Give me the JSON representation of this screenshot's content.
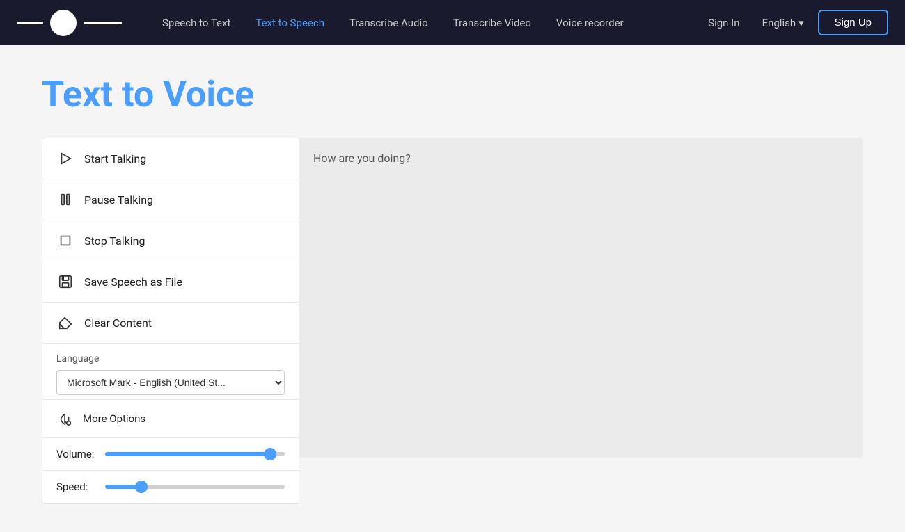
{
  "nav": {
    "links": [
      {
        "id": "speech-to-text",
        "label": "Speech to Text",
        "active": false
      },
      {
        "id": "text-to-speech",
        "label": "Text to Speech",
        "active": true
      },
      {
        "id": "transcribe-audio",
        "label": "Transcribe Audio",
        "active": false
      },
      {
        "id": "transcribe-video",
        "label": "Transcribe Video",
        "active": false
      },
      {
        "id": "voice-recorder",
        "label": "Voice recorder",
        "active": false
      }
    ],
    "signin_label": "Sign In",
    "lang_label": "English",
    "signup_label": "Sign Up"
  },
  "page": {
    "title": "Text to Voice"
  },
  "sidebar": {
    "start_label": "Start Talking",
    "pause_label": "Pause Talking",
    "stop_label": "Stop Talking",
    "save_label": "Save Speech as File",
    "clear_label": "Clear Content",
    "language_section_label": "Language",
    "language_option": "Microsoft Mark - English (United St...",
    "more_options_label": "More Options",
    "volume_label": "Volume:",
    "speed_label": "Speed:",
    "volume_value": 95,
    "speed_value": 18
  },
  "textarea": {
    "placeholder": "How are you doing?"
  }
}
